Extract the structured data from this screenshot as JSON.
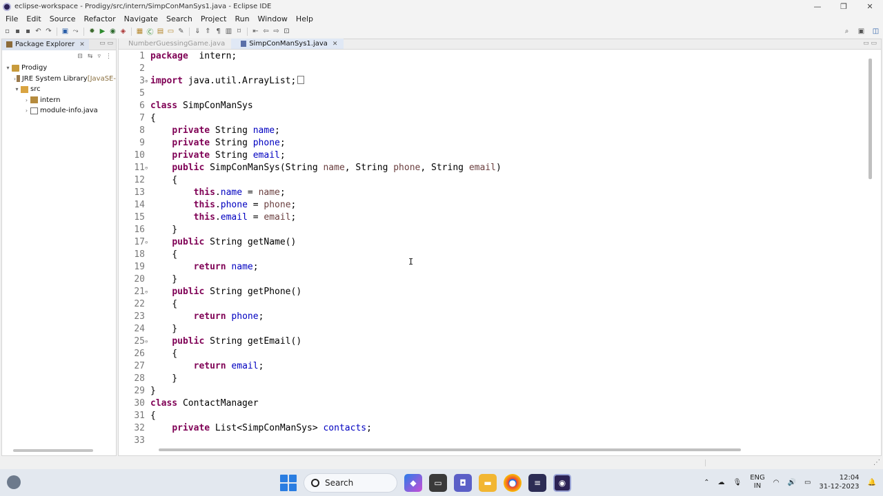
{
  "window": {
    "title": "eclipse-workspace - Prodigy/src/intern/SimpConManSys1.java - Eclipse IDE",
    "controls": [
      "—",
      "❐",
      "✕"
    ]
  },
  "menu": [
    "File",
    "Edit",
    "Source",
    "Refactor",
    "Navigate",
    "Search",
    "Project",
    "Run",
    "Window",
    "Help"
  ],
  "package_explorer": {
    "tab_label": "Package Explorer",
    "tree": [
      {
        "arrow": "▾",
        "indent": 0,
        "icon": "project",
        "label": "Prodigy",
        "suffix": ""
      },
      {
        "arrow": "›",
        "indent": 1,
        "icon": "lib",
        "label": "JRE System Library",
        "suffix": " [JavaSE-"
      },
      {
        "arrow": "▾",
        "indent": 1,
        "icon": "src",
        "label": "src",
        "suffix": ""
      },
      {
        "arrow": "›",
        "indent": 2,
        "icon": "pkg",
        "label": "intern",
        "suffix": ""
      },
      {
        "arrow": "›",
        "indent": 2,
        "icon": "file",
        "label": "module-info.java",
        "suffix": ""
      }
    ]
  },
  "editor": {
    "tabs": [
      {
        "label": "NumberGuessingGame.java",
        "active": false
      },
      {
        "label": "SimpConManSys1.java",
        "active": true
      }
    ],
    "lines": [
      {
        "n": "1",
        "fold": "",
        "segs": [
          [
            "kw",
            "package"
          ],
          [
            "",
            "  "
          ],
          [
            "",
            "intern;"
          ]
        ]
      },
      {
        "n": "2",
        "fold": "",
        "segs": []
      },
      {
        "n": "3",
        "fold": "⊕",
        "segs": [
          [
            "kw",
            "import"
          ],
          [
            "",
            " java.util.ArrayList;"
          ],
          [
            "box",
            ""
          ]
        ]
      },
      {
        "n": "5",
        "fold": "",
        "segs": []
      },
      {
        "n": "6",
        "fold": "",
        "segs": [
          [
            "kw",
            "class"
          ],
          [
            "",
            " SimpConManSys"
          ]
        ]
      },
      {
        "n": "7",
        "fold": "",
        "segs": [
          [
            "",
            "{"
          ]
        ]
      },
      {
        "n": "8",
        "fold": "",
        "segs": [
          [
            "",
            "    "
          ],
          [
            "kw",
            "private"
          ],
          [
            "",
            " String "
          ],
          [
            "fld",
            "name"
          ],
          [
            "",
            ";"
          ]
        ]
      },
      {
        "n": "9",
        "fold": "",
        "segs": [
          [
            "",
            "    "
          ],
          [
            "kw",
            "private"
          ],
          [
            "",
            " String "
          ],
          [
            "fld",
            "phone"
          ],
          [
            "",
            ";"
          ]
        ]
      },
      {
        "n": "10",
        "fold": "",
        "segs": [
          [
            "",
            "    "
          ],
          [
            "kw",
            "private"
          ],
          [
            "",
            " String "
          ],
          [
            "fld",
            "email"
          ],
          [
            "",
            ";"
          ]
        ]
      },
      {
        "n": "11",
        "fold": "⊖",
        "segs": [
          [
            "",
            "    "
          ],
          [
            "kw",
            "public"
          ],
          [
            "",
            " SimpConManSys(String "
          ],
          [
            "prm",
            "name"
          ],
          [
            "",
            ", String "
          ],
          [
            "prm",
            "phone"
          ],
          [
            "",
            ", String "
          ],
          [
            "prm",
            "email"
          ],
          [
            "",
            ")"
          ]
        ]
      },
      {
        "n": "12",
        "fold": "",
        "segs": [
          [
            "",
            "    {"
          ]
        ]
      },
      {
        "n": "13",
        "fold": "",
        "segs": [
          [
            "",
            "        "
          ],
          [
            "kw",
            "this"
          ],
          [
            "",
            "."
          ],
          [
            "fld",
            "name"
          ],
          [
            "",
            " = "
          ],
          [
            "prm",
            "name"
          ],
          [
            "",
            ";"
          ]
        ]
      },
      {
        "n": "14",
        "fold": "",
        "segs": [
          [
            "",
            "        "
          ],
          [
            "kw",
            "this"
          ],
          [
            "",
            "."
          ],
          [
            "fld",
            "phone"
          ],
          [
            "",
            " = "
          ],
          [
            "prm",
            "phone"
          ],
          [
            "",
            ";"
          ]
        ]
      },
      {
        "n": "15",
        "fold": "",
        "segs": [
          [
            "",
            "        "
          ],
          [
            "kw",
            "this"
          ],
          [
            "",
            "."
          ],
          [
            "fld",
            "email"
          ],
          [
            "",
            " = "
          ],
          [
            "prm",
            "email"
          ],
          [
            "",
            ";"
          ]
        ]
      },
      {
        "n": "16",
        "fold": "",
        "segs": [
          [
            "",
            "    }"
          ]
        ]
      },
      {
        "n": "17",
        "fold": "⊖",
        "segs": [
          [
            "",
            "    "
          ],
          [
            "kw",
            "public"
          ],
          [
            "",
            " String getName()"
          ]
        ]
      },
      {
        "n": "18",
        "fold": "",
        "segs": [
          [
            "",
            "    {"
          ]
        ]
      },
      {
        "n": "19",
        "fold": "",
        "segs": [
          [
            "",
            "        "
          ],
          [
            "kw",
            "return"
          ],
          [
            "",
            " "
          ],
          [
            "fld",
            "name"
          ],
          [
            "",
            ";"
          ]
        ]
      },
      {
        "n": "20",
        "fold": "",
        "segs": [
          [
            "",
            "    }"
          ]
        ]
      },
      {
        "n": "21",
        "fold": "⊖",
        "segs": [
          [
            "",
            "    "
          ],
          [
            "kw",
            "public"
          ],
          [
            "",
            " String getPhone()"
          ]
        ]
      },
      {
        "n": "22",
        "fold": "",
        "segs": [
          [
            "",
            "    {"
          ]
        ]
      },
      {
        "n": "23",
        "fold": "",
        "segs": [
          [
            "",
            "        "
          ],
          [
            "kw",
            "return"
          ],
          [
            "",
            " "
          ],
          [
            "fld",
            "phone"
          ],
          [
            "",
            ";"
          ]
        ]
      },
      {
        "n": "24",
        "fold": "",
        "segs": [
          [
            "",
            "    }"
          ]
        ]
      },
      {
        "n": "25",
        "fold": "⊖",
        "segs": [
          [
            "",
            "    "
          ],
          [
            "kw",
            "public"
          ],
          [
            "",
            " String getEmail()"
          ]
        ]
      },
      {
        "n": "26",
        "fold": "",
        "segs": [
          [
            "",
            "    {"
          ]
        ]
      },
      {
        "n": "27",
        "fold": "",
        "segs": [
          [
            "",
            "        "
          ],
          [
            "kw",
            "return"
          ],
          [
            "",
            " "
          ],
          [
            "fld",
            "email"
          ],
          [
            "",
            ";"
          ]
        ]
      },
      {
        "n": "28",
        "fold": "",
        "segs": [
          [
            "",
            "    }"
          ]
        ]
      },
      {
        "n": "29",
        "fold": "",
        "segs": [
          [
            "",
            "}"
          ]
        ]
      },
      {
        "n": "30",
        "fold": "",
        "segs": [
          [
            "kw",
            "class"
          ],
          [
            "",
            " ContactManager"
          ]
        ]
      },
      {
        "n": "31",
        "fold": "",
        "segs": [
          [
            "",
            "{"
          ]
        ]
      },
      {
        "n": "32",
        "fold": "",
        "segs": [
          [
            "",
            "    "
          ],
          [
            "kw",
            "private"
          ],
          [
            "",
            " List<SimpConManSys> "
          ],
          [
            "fld",
            "contacts"
          ],
          [
            "",
            ";"
          ]
        ]
      },
      {
        "n": "33",
        "fold": "",
        "segs": []
      }
    ]
  },
  "taskbar": {
    "search_label": "Search",
    "lang_top": "ENG",
    "lang_bottom": "IN",
    "time": "12:04",
    "date": "31-12-2023"
  },
  "colors": {
    "keyword": "#7f0055",
    "field": "#0000c0",
    "parameter": "#6a3e3e",
    "line_number": "#787878"
  }
}
